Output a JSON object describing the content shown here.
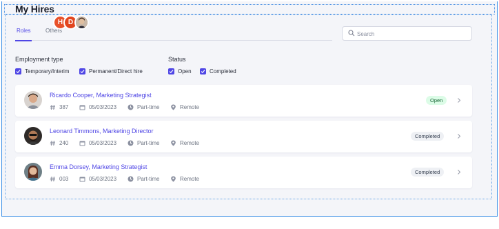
{
  "page": {
    "title": "My Hires"
  },
  "tabs": [
    {
      "label": "Roles"
    },
    {
      "label": "Others"
    }
  ],
  "avatars": [
    {
      "initial": "H"
    },
    {
      "initial": "D"
    }
  ],
  "search": {
    "placeholder": "Search"
  },
  "filters": {
    "employment_type": {
      "heading": "Employment type",
      "options": [
        {
          "label": "Temporary/Interim"
        },
        {
          "label": "Permanent/Direct hire"
        }
      ]
    },
    "status": {
      "heading": "Status",
      "options": [
        {
          "label": "Open"
        },
        {
          "label": "Completed"
        }
      ]
    }
  },
  "hires": [
    {
      "name": "Ricardo Cooper, Marketing Strategist",
      "id": "387",
      "date": "05/03/2023",
      "schedule": "Part-time",
      "location": "Remote",
      "status": "Open"
    },
    {
      "name": "Leonard Timmons, Marketing Director",
      "id": "240",
      "date": "05/03/2023",
      "schedule": "Part-time",
      "location": "Remote",
      "status": "Completed"
    },
    {
      "name": "Emma Dorsey, Marketing Strategist",
      "id": "003",
      "date": "05/03/2023",
      "schedule": "Part-time",
      "location": "Remote",
      "status": "Completed"
    }
  ],
  "colors": {
    "accent": "#4f46e5",
    "open_badge_bg": "#dcfce7",
    "completed_badge_bg": "#eef0f4",
    "selection_border": "#3b8fe6"
  },
  "icons": {
    "search": "search-icon",
    "id": "hash-icon",
    "date": "calendar-icon",
    "schedule": "clock-icon",
    "location": "map-pin-icon",
    "row_action": "chevron-right-icon",
    "checkbox": "check-icon"
  }
}
